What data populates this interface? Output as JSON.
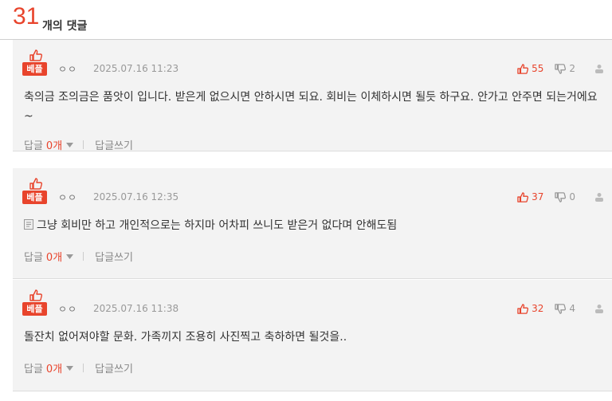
{
  "header": {
    "count": "31",
    "count_label": "개의 댓글"
  },
  "comments": [
    {
      "badge": "베플",
      "author": "ㅇㅇ",
      "date": "2025.07.16 11:23",
      "likes": "55",
      "dislikes": "2",
      "text": "축의금 조의금은 품앗이 입니다. 받은게 없으시면 안하시면 되요. 회비는 이체하시면 될듯 하구요. 안가고 안주면 되는거에요~",
      "reply_label": "답글",
      "reply_count": "0개",
      "write_reply": "답글쓰기"
    },
    {
      "badge": "베플",
      "author": "ㅇㅇ",
      "date": "2025.07.16 12:35",
      "likes": "37",
      "dislikes": "0",
      "text": "그냥 회비만 하고 개인적으로는 하지마 어차피 쓰니도 받은거 없다며 안해도됨",
      "reply_label": "답글",
      "reply_count": "0개",
      "write_reply": "답글쓰기"
    },
    {
      "badge": "베플",
      "author": "ㅇㅇ",
      "date": "2025.07.16 11:38",
      "likes": "32",
      "dislikes": "4",
      "text": "돌잔치 없어져야할 문화. 가족끼지 조용히 사진찍고 축하하면 될것을..",
      "reply_label": "답글",
      "reply_count": "0개",
      "write_reply": "답글쓰기"
    }
  ],
  "colors": {
    "accent": "#e8442c",
    "comment_bg": "#f3f3f3",
    "muted": "#888888"
  }
}
